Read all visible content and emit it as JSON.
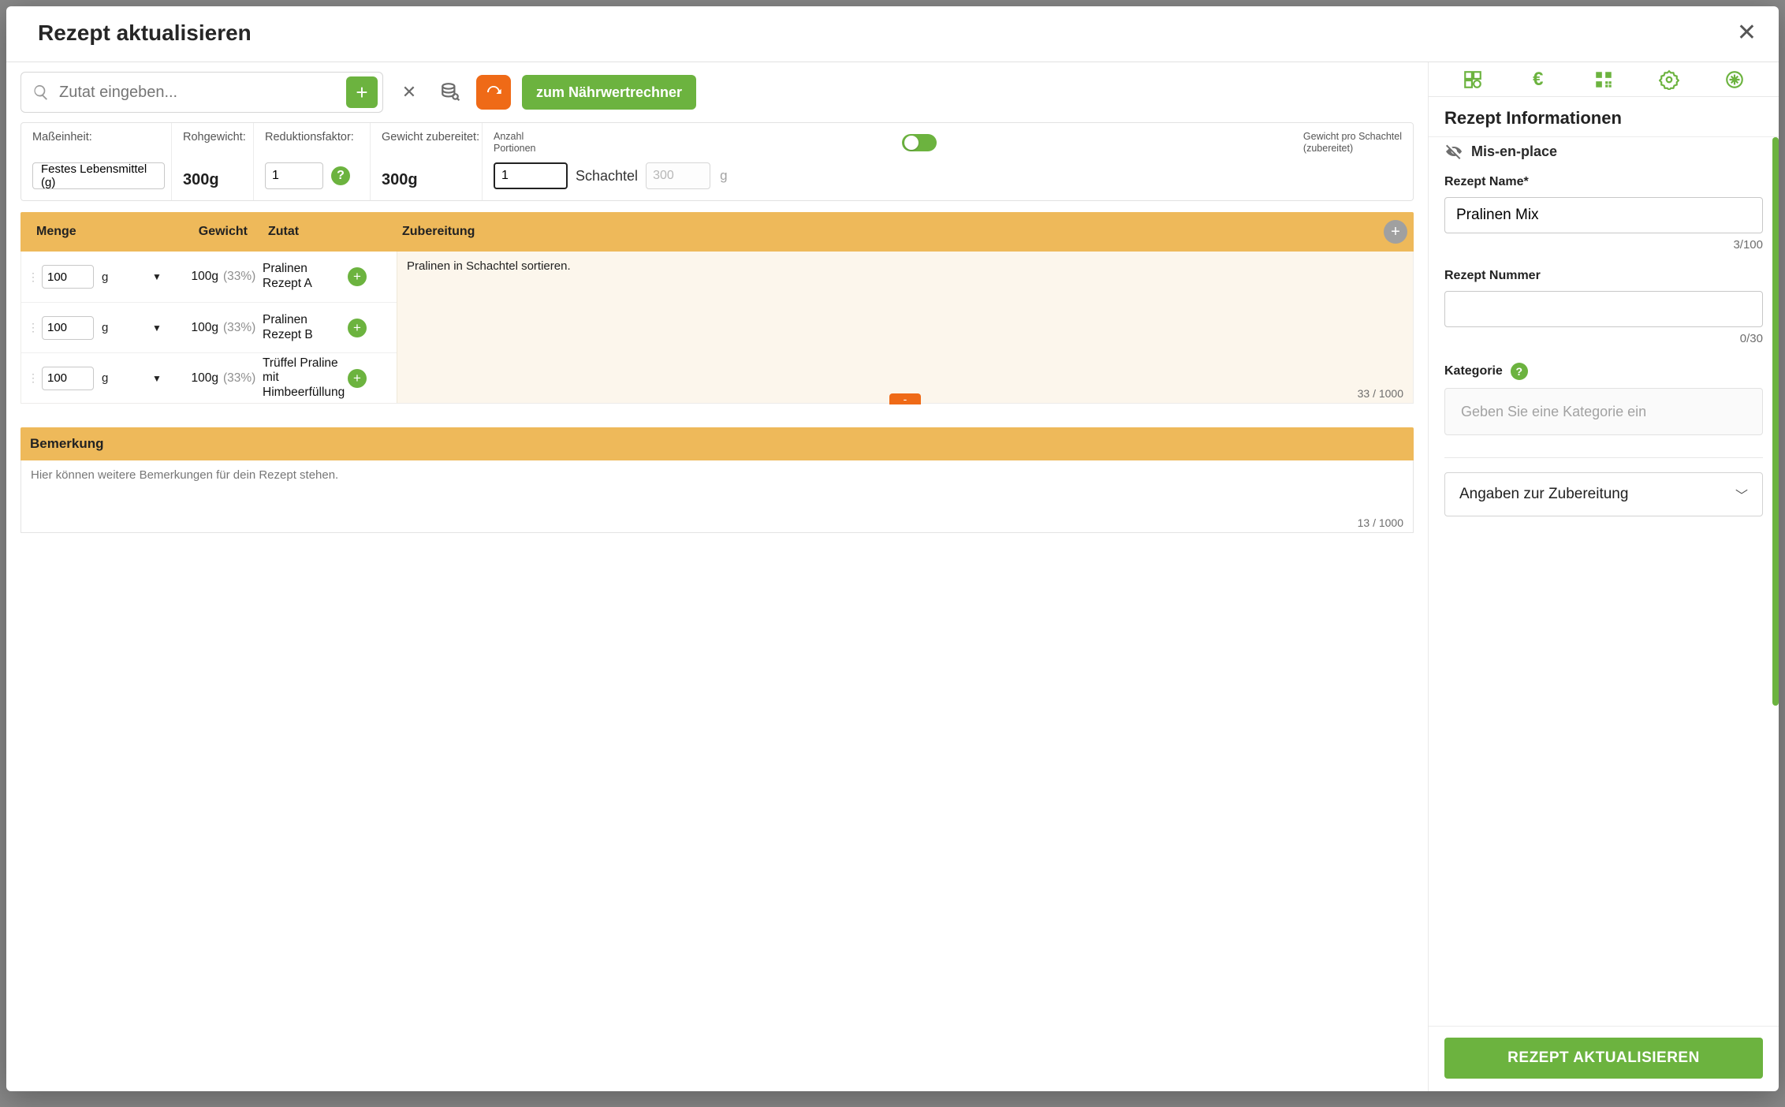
{
  "modal": {
    "title": "Rezept aktualisieren"
  },
  "search": {
    "placeholder": "Zutat eingeben...",
    "nahrwert_button": "zum Nährwertrechner"
  },
  "props": {
    "masseinheit_label": "Maßeinheit:",
    "masseinheit_value": "Festes Lebensmittel (g)",
    "rohgewicht_label": "Rohgewicht:",
    "rohgewicht_value": "300g",
    "reduktion_label": "Reduktionsfaktor:",
    "reduktion_value": "1",
    "gewicht_zub_label": "Gewicht zubereitet:",
    "gewicht_zub_value": "300g",
    "anzahl_portionen_label": "Anzahl\nPortionen",
    "gewicht_pro_label": "Gewicht pro Schachtel\n(zubereitet)",
    "portionen_value": "1",
    "portionen_unit": "Schachtel",
    "weight_per_value": "300",
    "weight_per_unit": "g"
  },
  "table": {
    "hdr_menge": "Menge",
    "hdr_gewicht": "Gewicht",
    "hdr_zutat": "Zutat",
    "hdr_zubereitung": "Zubereitung",
    "rows": [
      {
        "amount": "100",
        "unit": "g",
        "weight": "100g",
        "pct": "(33%)",
        "name": "Pralinen Rezept A"
      },
      {
        "amount": "100",
        "unit": "g",
        "weight": "100g",
        "pct": "(33%)",
        "name": "Pralinen Rezept B"
      },
      {
        "amount": "100",
        "unit": "g",
        "weight": "100g",
        "pct": "(33%)",
        "name": "Trüffel Praline mit Himbeerfüllung"
      }
    ],
    "zubereitung_text": "Pralinen in Schachtel sortieren.",
    "zubereitung_counter": "33 / 1000"
  },
  "bemerkung": {
    "header": "Bemerkung",
    "text": "Hier können weitere Bemerkungen für dein Rezept stehen.",
    "counter": "13 / 1000"
  },
  "right": {
    "section_title": "Rezept Informationen",
    "mep": "Mis-en-place",
    "name_label": "Rezept Name*",
    "name_value": "Pralinen Mix",
    "name_counter": "3/100",
    "nummer_label": "Rezept Nummer",
    "nummer_value": "",
    "nummer_counter": "0/30",
    "kategorie_label": "Kategorie",
    "kategorie_placeholder": "Geben Sie eine Kategorie ein",
    "zubereitung_dropdown": "Angaben zur Zubereitung",
    "save_button": "REZEPT AKTUALISIEREN"
  }
}
